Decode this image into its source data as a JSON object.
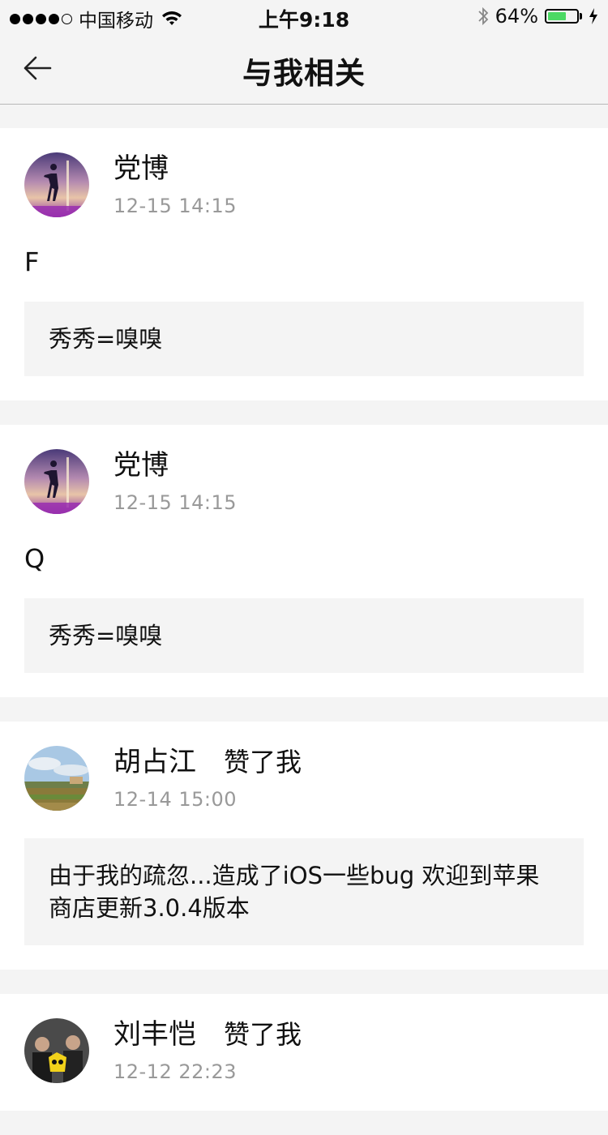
{
  "status": {
    "carrier": "中国移动",
    "time": "上午9:18",
    "battery": "64%",
    "battery_level": 0.64,
    "battery_color": "#4cd964"
  },
  "nav": {
    "title": "与我相关",
    "back_icon": "arrow-left-icon"
  },
  "feed": [
    {
      "name": "党博",
      "liked": "",
      "time": "12-15 14:15",
      "comment": "F",
      "quote": "秀秀=嗅嗅"
    },
    {
      "name": "党博",
      "liked": "",
      "time": "12-15 14:15",
      "comment": "Q",
      "quote": "秀秀=嗅嗅"
    },
    {
      "name": "胡占江",
      "liked": "赞了我",
      "time": "12-14 15:00",
      "comment": "",
      "quote": "由于我的疏忽...造成了iOS一些bug 欢迎到苹果商店更新3.0.4版本"
    },
    {
      "name": "刘丰恺",
      "liked": "赞了我",
      "time": "12-12 22:23",
      "comment": "",
      "quote": ""
    }
  ]
}
